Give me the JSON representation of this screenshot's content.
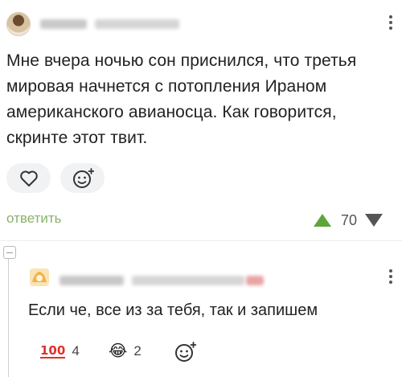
{
  "comment": {
    "text": "Мне вчера ночью сон приснился, что третья мировая начнется с потопления Ираном американского авианосца. Как говорится, скринте этот твит.",
    "reply_label": "ответить",
    "rating": "70"
  },
  "reply": {
    "text": "Если че, все из за тебя, так и запишем",
    "reactions": [
      {
        "icon": "hundred-points-icon",
        "glyph": "100",
        "count": "4"
      },
      {
        "icon": "tears-of-joy-icon",
        "glyph": "😂",
        "count": "2"
      }
    ]
  },
  "colors": {
    "accent_green": "#8ab26a",
    "upvote_green": "#5ea53a",
    "downvote_gray": "#555555"
  }
}
